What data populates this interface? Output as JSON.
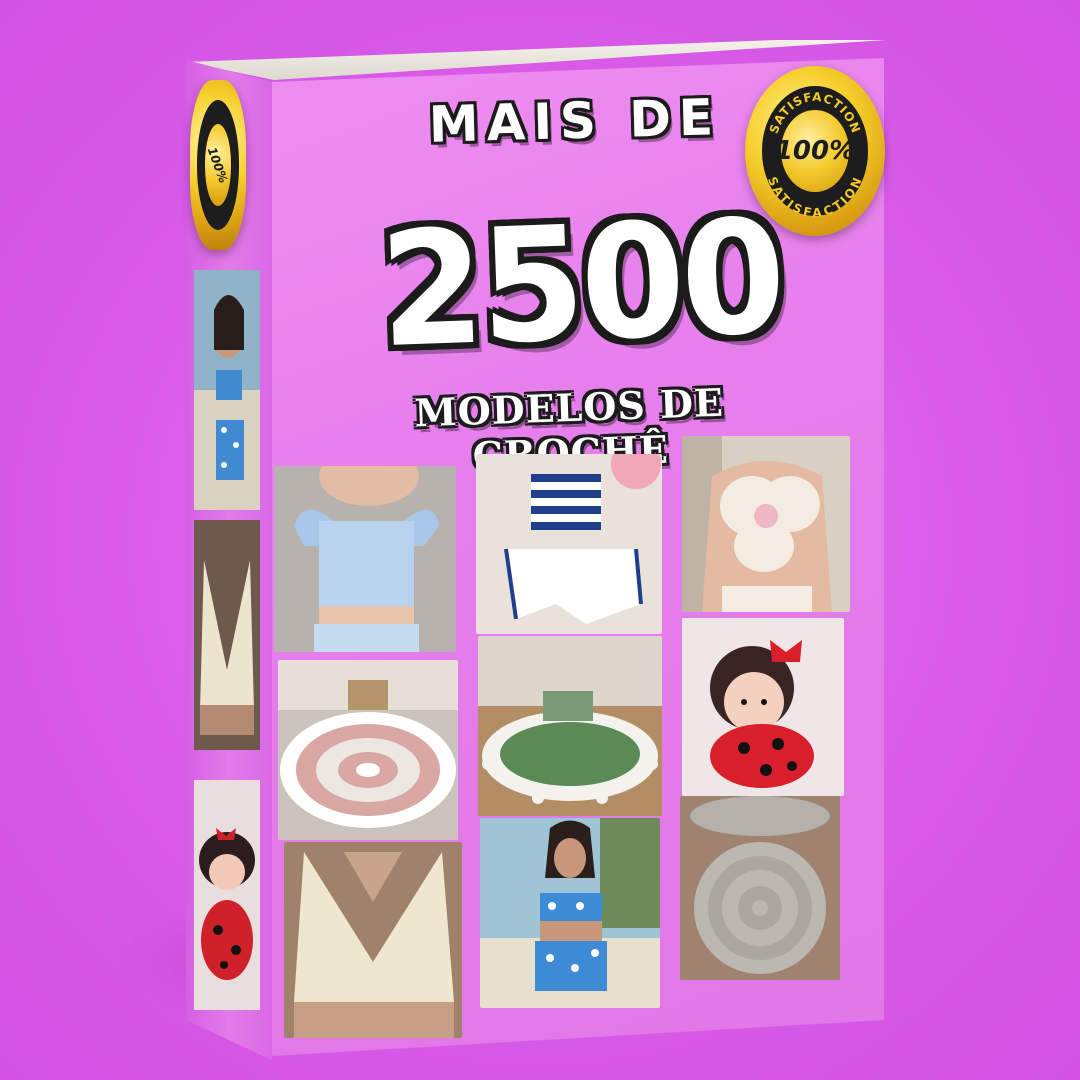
{
  "cover": {
    "line1": "MAIS DE",
    "number": "2500",
    "line3": "MODELOS DE CROCHÊ"
  },
  "badge": {
    "top_text": "SATISFACTION",
    "center_text": "100%",
    "bottom_text": "SATISFACTION"
  },
  "spine_badge": {
    "center_text": "100%"
  },
  "photos": [
    {
      "name": "blue-ruffle-crop-top-photo"
    },
    {
      "name": "striped-halter-and-shorts-photo"
    },
    {
      "name": "flower-halter-top-photo"
    },
    {
      "name": "round-pink-rug-photo"
    },
    {
      "name": "round-green-rug-photo"
    },
    {
      "name": "ladybug-amigurumi-doll-photo"
    },
    {
      "name": "cream-v-neck-crop-top-photo"
    },
    {
      "name": "blue-daisy-bikini-set-photo"
    },
    {
      "name": "grey-round-doily-photo"
    }
  ],
  "colors": {
    "background": "#dd63ec",
    "cover": "#e67eec",
    "badge_gold": "#f6cf2b",
    "outline": "#1b1b1b"
  }
}
